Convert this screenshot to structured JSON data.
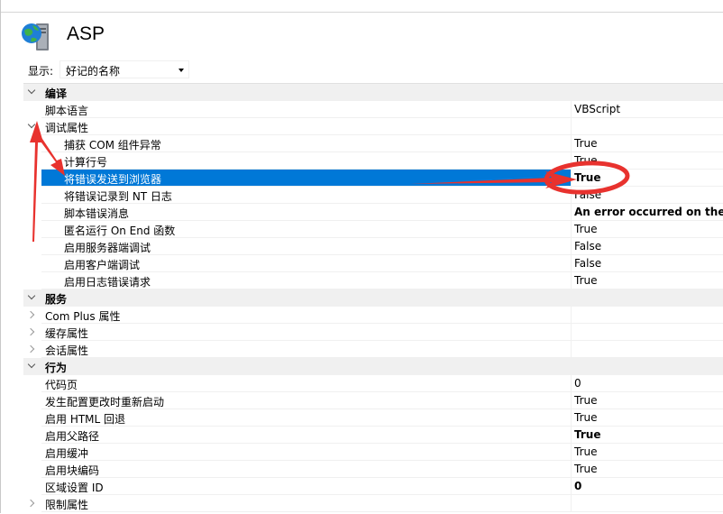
{
  "header": {
    "title": "ASP"
  },
  "display": {
    "label": "显示:",
    "selected": "好记的名称"
  },
  "rows": [
    {
      "type": "category",
      "name": "编译",
      "expanded": true
    },
    {
      "type": "prop",
      "name": "脚本语言",
      "value": "VBScript",
      "bold": false,
      "indent": false
    },
    {
      "type": "group",
      "name": "调试属性",
      "expanded": true
    },
    {
      "type": "prop",
      "name": "捕获 COM 组件异常",
      "value": "True",
      "bold": false,
      "indent": true
    },
    {
      "type": "prop",
      "name": "计算行号",
      "value": "True",
      "bold": false,
      "indent": true
    },
    {
      "type": "prop",
      "name": "将错误发送到浏览器",
      "value": "True",
      "bold": true,
      "indent": true,
      "selected": true
    },
    {
      "type": "prop",
      "name": "将错误记录到 NT 日志",
      "value": "False",
      "bold": false,
      "indent": true
    },
    {
      "type": "prop",
      "name": "脚本错误消息",
      "value": "An error occurred on the se",
      "bold": true,
      "indent": true
    },
    {
      "type": "prop",
      "name": "匿名运行 On End 函数",
      "value": "True",
      "bold": false,
      "indent": true
    },
    {
      "type": "prop",
      "name": "启用服务器端调试",
      "value": "False",
      "bold": false,
      "indent": true
    },
    {
      "type": "prop",
      "name": "启用客户端调试",
      "value": "False",
      "bold": false,
      "indent": true
    },
    {
      "type": "prop",
      "name": "启用日志错误请求",
      "value": "True",
      "bold": false,
      "indent": true
    },
    {
      "type": "category",
      "name": "服务",
      "expanded": true
    },
    {
      "type": "group",
      "name": "Com Plus 属性",
      "expanded": false
    },
    {
      "type": "group",
      "name": "缓存属性",
      "expanded": false
    },
    {
      "type": "group",
      "name": "会话属性",
      "expanded": false
    },
    {
      "type": "category",
      "name": "行为",
      "expanded": true
    },
    {
      "type": "prop",
      "name": "代码页",
      "value": "0",
      "bold": false,
      "indent": false
    },
    {
      "type": "prop",
      "name": "发生配置更改时重新启动",
      "value": "True",
      "bold": false,
      "indent": false
    },
    {
      "type": "prop",
      "name": "启用 HTML 回退",
      "value": "True",
      "bold": false,
      "indent": false
    },
    {
      "type": "prop",
      "name": "启用父路径",
      "value": "True",
      "bold": true,
      "indent": false
    },
    {
      "type": "prop",
      "name": "启用缓冲",
      "value": "True",
      "bold": false,
      "indent": false
    },
    {
      "type": "prop",
      "name": "启用块编码",
      "value": "True",
      "bold": false,
      "indent": false
    },
    {
      "type": "prop",
      "name": "区域设置 ID",
      "value": "0",
      "bold": true,
      "indent": false
    },
    {
      "type": "group",
      "name": "限制属性",
      "expanded": false
    }
  ],
  "colors": {
    "selection": "#0078d7",
    "category_bg": "#f0f0f0",
    "annotation": "#e8322e"
  },
  "icons": {
    "logo": "asp-globe-server-icon",
    "expanded": "chevron-down-icon",
    "collapsed": "chevron-right-icon"
  }
}
